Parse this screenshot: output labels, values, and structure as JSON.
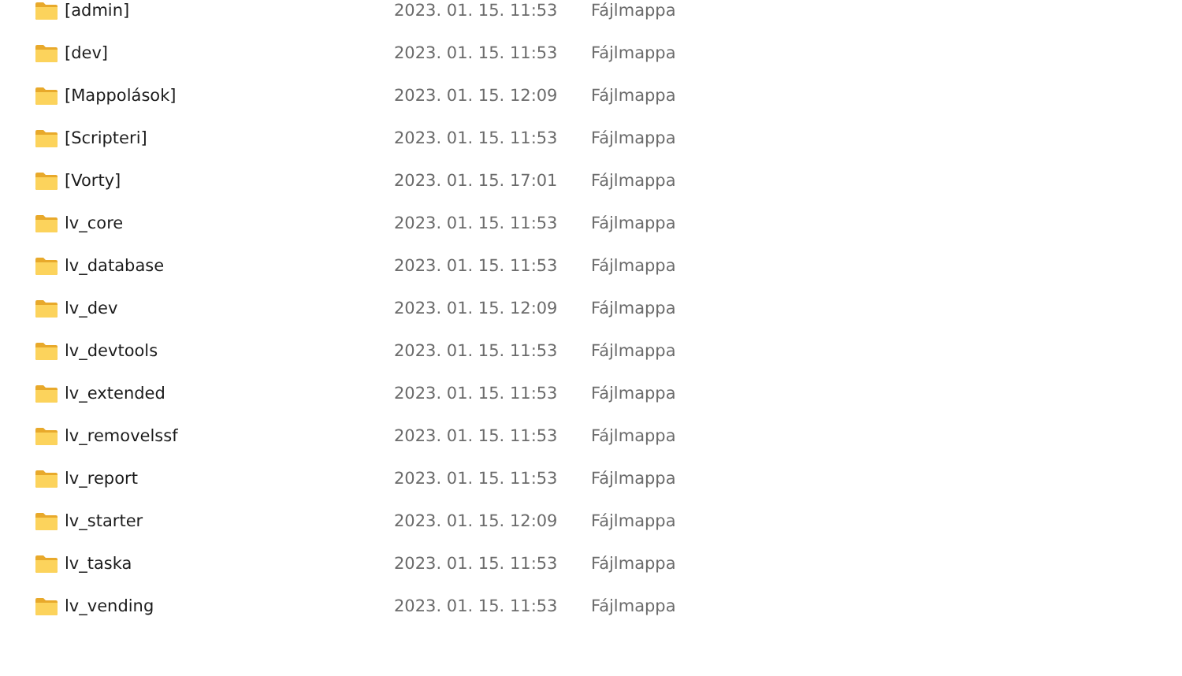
{
  "files": [
    {
      "name": "[admin]",
      "modified": "2023. 01. 15. 11:53",
      "type": "Fájlmappa"
    },
    {
      "name": "[dev]",
      "modified": "2023. 01. 15. 11:53",
      "type": "Fájlmappa"
    },
    {
      "name": "[Mappolások]",
      "modified": "2023. 01. 15. 12:09",
      "type": "Fájlmappa"
    },
    {
      "name": "[Scripteri]",
      "modified": "2023. 01. 15. 11:53",
      "type": "Fájlmappa"
    },
    {
      "name": "[Vorty]",
      "modified": "2023. 01. 15. 17:01",
      "type": "Fájlmappa"
    },
    {
      "name": "lv_core",
      "modified": "2023. 01. 15. 11:53",
      "type": "Fájlmappa"
    },
    {
      "name": "lv_database",
      "modified": "2023. 01. 15. 11:53",
      "type": "Fájlmappa"
    },
    {
      "name": "lv_dev",
      "modified": "2023. 01. 15. 12:09",
      "type": "Fájlmappa"
    },
    {
      "name": "lv_devtools",
      "modified": "2023. 01. 15. 11:53",
      "type": "Fájlmappa"
    },
    {
      "name": "lv_extended",
      "modified": "2023. 01. 15. 11:53",
      "type": "Fájlmappa"
    },
    {
      "name": "lv_removelssf",
      "modified": "2023. 01. 15. 11:53",
      "type": "Fájlmappa"
    },
    {
      "name": "lv_report",
      "modified": "2023. 01. 15. 11:53",
      "type": "Fájlmappa"
    },
    {
      "name": "lv_starter",
      "modified": "2023. 01. 15. 12:09",
      "type": "Fájlmappa"
    },
    {
      "name": "lv_taska",
      "modified": "2023. 01. 15. 11:53",
      "type": "Fájlmappa"
    },
    {
      "name": "lv_vending",
      "modified": "2023. 01. 15. 11:53",
      "type": "Fájlmappa"
    }
  ]
}
